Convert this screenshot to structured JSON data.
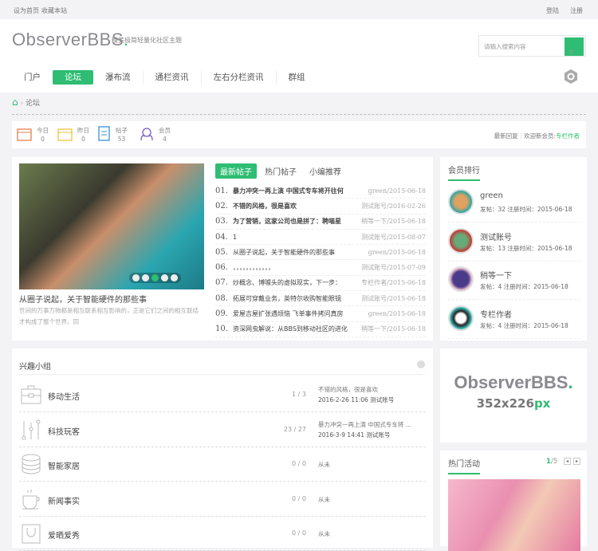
{
  "topbar": {
    "set_home": "设为首页",
    "bookmark": "收藏本站",
    "login": "登陆",
    "register": "注册"
  },
  "header": {
    "logo": "ObserverBBS",
    "logo_dot": ".",
    "slogan": "精美极简轻量化社区主题",
    "search_placeholder": "请输入搜索内容"
  },
  "nav": [
    "门户",
    "论坛",
    "瀑布流",
    "通栏资讯",
    "左右分栏资讯",
    "群组"
  ],
  "breadcrumb": {
    "current": "论坛"
  },
  "stats": [
    {
      "label": "今日",
      "value": "0",
      "color": "#e8804a"
    },
    {
      "label": "昨日",
      "value": "0",
      "color": "#f0c040"
    },
    {
      "label": "帖子",
      "value": "53",
      "color": "#3a8fd8"
    },
    {
      "label": "会员",
      "value": "4",
      "color": "#7b5cc8"
    }
  ],
  "stats_right": {
    "latest": "最新回复",
    "welcome": "欢迎新会员:",
    "new_member": "专栏作者"
  },
  "featured": {
    "title": "从圈子说起，关于智能硬件的那些事",
    "summary": "世间的万事万物都是相互联系相互影响的，正是它们之间的相互联结才构成了整个世界。同"
  },
  "post_tabs": [
    "最新帖子",
    "热门帖子",
    "小编推荐"
  ],
  "posts": [
    {
      "num": "01.",
      "title": "暴力冲突一再上演 中国式专车将开往何",
      "meta": "green/2015-06-18",
      "bold": true
    },
    {
      "num": "02.",
      "title": "不错的风格，很是喜欢",
      "meta": "测试账号/2016-02-26",
      "bold": true
    },
    {
      "num": "03.",
      "title": "为了营销，这家公司也是拼了：聘喵星",
      "meta": "稍等一下/2015-06-18",
      "bold": true
    },
    {
      "num": "04.",
      "title": "1",
      "meta": "测试账号/2015-08-07",
      "bold": false
    },
    {
      "num": "05.",
      "title": "从圈子说起，关于智能硬件的那些事",
      "meta": "green/2015-06-18",
      "bold": false
    },
    {
      "num": "06.",
      "title": "，，，，，，，，，，，，",
      "meta": "测试账号/2015-07-09",
      "bold": false
    },
    {
      "num": "07.",
      "title": "炒概念、博噱头的虚拟现实，下一步：",
      "meta": "专栏作者/2015-06-18",
      "bold": false
    },
    {
      "num": "08.",
      "title": "拓展可穿戴业务，英特尔收购智能眼镜",
      "meta": "测试账号/2015-06-18",
      "bold": false
    },
    {
      "num": "09.",
      "title": "爱屋吉屋扩张遇烦恼 飞单事件拷问真房",
      "meta": "green/2015-06-18",
      "bold": false
    },
    {
      "num": "10.",
      "title": "资深网虫解说：从BBS到移动社区的进化",
      "meta": "稍等一下/2015-06-18",
      "bold": false
    }
  ],
  "ranking": {
    "title": "会员排行",
    "members": [
      {
        "name": "green",
        "info": "发帖：32   注册时间：2015-06-18"
      },
      {
        "name": "测试账号",
        "info": "发帖：13   注册时间：2015-06-18"
      },
      {
        "name": "稍等一下",
        "info": "发帖：4   注册时间：2015-06-18"
      },
      {
        "name": "专栏作者",
        "info": "发帖：4   注册时间：2015-06-18"
      }
    ]
  },
  "groups": {
    "title": "兴趣小组",
    "items": [
      {
        "name": "移动生活",
        "count": "1 / 3",
        "last_title": "不错的风格，很是喜欢",
        "last_meta": "2016-2-26 11:06 测试账号",
        "icon": "briefcase-icon"
      },
      {
        "name": "科技玩客",
        "count": "23 / 27",
        "last_title": "暴力冲突一再上演 中国式专车将 ...",
        "last_meta": "2016-3-9 14:41 测试账号",
        "icon": "sliders-icon"
      },
      {
        "name": "智能家居",
        "count": "0 / 0",
        "last_title": "从未",
        "last_meta": "",
        "icon": "database-icon"
      },
      {
        "name": "新闻事实",
        "count": "0 / 0",
        "last_title": "从未",
        "last_meta": "",
        "icon": "coffee-cup-icon"
      },
      {
        "name": "爱晒爱秀",
        "count": "0 / 0",
        "last_title": "从未",
        "last_meta": "",
        "icon": "bag-icon"
      }
    ]
  },
  "ad": {
    "logo": "ObserverBBS",
    "logo_dot": ".",
    "size": "352x226",
    "unit": "px"
  },
  "events": {
    "title": "热门活动",
    "page": "1",
    "total": "/5"
  },
  "colors": {
    "accent": "#2ebd72",
    "background": "#f3f2f5"
  }
}
